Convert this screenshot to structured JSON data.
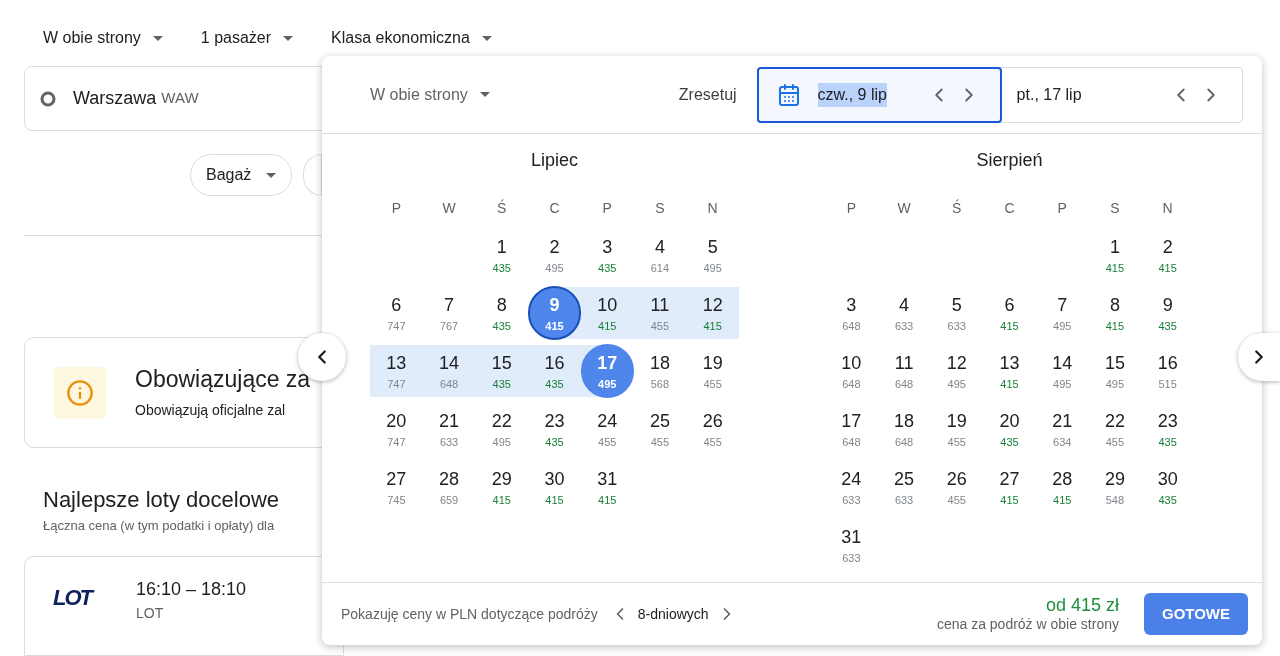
{
  "top_bar": {
    "dropdowns": [
      {
        "label": "W obie strony"
      },
      {
        "label": "1 pasażer"
      },
      {
        "label": "Klasa ekonomiczna"
      }
    ]
  },
  "origin": {
    "city": "Warszawa",
    "code": "WAW"
  },
  "filters": [
    {
      "label": "Bagaż"
    }
  ],
  "notice": {
    "title": "Obowiązujące za",
    "text": "Obowiązują oficjalne zal"
  },
  "best_flights": {
    "title": "Najlepsze loty docelowe",
    "subtitle": "Łączna cena (w tym podatki i opłaty) dla"
  },
  "flight": {
    "logo": "LOT",
    "times": "16:10 – 18:10",
    "airline": "LOT"
  },
  "picker": {
    "trip_type": "W obie strony",
    "reset": "Zresetuj",
    "fields": [
      {
        "value": "czw., 9 lip",
        "active": true
      },
      {
        "value": "pt., 17 lip",
        "active": false
      }
    ],
    "months": [
      {
        "name": "Lipiec",
        "weekdays": [
          "P",
          "W",
          "Ś",
          "C",
          "P",
          "S",
          "N"
        ],
        "weeks": [
          [
            {
              "kind": "blank"
            },
            {
              "kind": "blank"
            },
            {
              "kind": "day",
              "day": "1",
              "price": "435",
              "cheap": true
            },
            {
              "kind": "day",
              "day": "2",
              "price": "495",
              "cheap": false
            },
            {
              "kind": "day",
              "day": "3",
              "price": "435",
              "cheap": true
            },
            {
              "kind": "day",
              "day": "4",
              "price": "614",
              "cheap": false
            },
            {
              "kind": "day",
              "day": "5",
              "price": "495",
              "cheap": false
            }
          ],
          [
            {
              "kind": "day",
              "day": "6",
              "price": "747",
              "cheap": false
            },
            {
              "kind": "day",
              "day": "7",
              "price": "767",
              "cheap": false
            },
            {
              "kind": "day",
              "day": "8",
              "price": "435",
              "cheap": true
            },
            {
              "kind": "day",
              "day": "9",
              "price": "415",
              "range_start": true
            },
            {
              "kind": "day",
              "day": "10",
              "price": "415",
              "cheap": true,
              "in_range": true
            },
            {
              "kind": "day",
              "day": "11",
              "price": "455",
              "cheap": false,
              "in_range": true
            },
            {
              "kind": "day",
              "day": "12",
              "price": "415",
              "cheap": true,
              "in_range": true
            }
          ],
          [
            {
              "kind": "day",
              "day": "13",
              "price": "747",
              "cheap": false,
              "in_range": true
            },
            {
              "kind": "day",
              "day": "14",
              "price": "648",
              "cheap": false,
              "in_range": true
            },
            {
              "kind": "day",
              "day": "15",
              "price": "435",
              "cheap": true,
              "in_range": true
            },
            {
              "kind": "day",
              "day": "16",
              "price": "435",
              "cheap": true,
              "in_range": true
            },
            {
              "kind": "day",
              "day": "17",
              "price": "495",
              "range_end": true
            },
            {
              "kind": "day",
              "day": "18",
              "price": "568",
              "cheap": false
            },
            {
              "kind": "day",
              "day": "19",
              "price": "455",
              "cheap": false
            }
          ],
          [
            {
              "kind": "day",
              "day": "20",
              "price": "747",
              "cheap": false
            },
            {
              "kind": "day",
              "day": "21",
              "price": "633",
              "cheap": false
            },
            {
              "kind": "day",
              "day": "22",
              "price": "495",
              "cheap": false
            },
            {
              "kind": "day",
              "day": "23",
              "price": "435",
              "cheap": true
            },
            {
              "kind": "day",
              "day": "24",
              "price": "455",
              "cheap": false
            },
            {
              "kind": "day",
              "day": "25",
              "price": "455",
              "cheap": false
            },
            {
              "kind": "day",
              "day": "26",
              "price": "455",
              "cheap": false
            }
          ],
          [
            {
              "kind": "day",
              "day": "27",
              "price": "745",
              "cheap": false
            },
            {
              "kind": "day",
              "day": "28",
              "price": "659",
              "cheap": false
            },
            {
              "kind": "day",
              "day": "29",
              "price": "415",
              "cheap": true
            },
            {
              "kind": "day",
              "day": "30",
              "price": "415",
              "cheap": true
            },
            {
              "kind": "day",
              "day": "31",
              "price": "415",
              "cheap": true
            }
          ]
        ]
      },
      {
        "name": "Sierpień",
        "weekdays": [
          "P",
          "W",
          "Ś",
          "C",
          "P",
          "S",
          "N"
        ],
        "weeks": [
          [
            {
              "kind": "blank"
            },
            {
              "kind": "blank"
            },
            {
              "kind": "blank"
            },
            {
              "kind": "blank"
            },
            {
              "kind": "blank"
            },
            {
              "kind": "day",
              "day": "1",
              "price": "415",
              "cheap": true
            },
            {
              "kind": "day",
              "day": "2",
              "price": "415",
              "cheap": true
            }
          ],
          [
            {
              "kind": "day",
              "day": "3",
              "price": "648",
              "cheap": false
            },
            {
              "kind": "day",
              "day": "4",
              "price": "633",
              "cheap": false
            },
            {
              "kind": "day",
              "day": "5",
              "price": "633",
              "cheap": false
            },
            {
              "kind": "day",
              "day": "6",
              "price": "415",
              "cheap": true
            },
            {
              "kind": "day",
              "day": "7",
              "price": "495",
              "cheap": false
            },
            {
              "kind": "day",
              "day": "8",
              "price": "415",
              "cheap": true
            },
            {
              "kind": "day",
              "day": "9",
              "price": "435",
              "cheap": true
            }
          ],
          [
            {
              "kind": "day",
              "day": "10",
              "price": "648",
              "cheap": false
            },
            {
              "kind": "day",
              "day": "11",
              "price": "648",
              "cheap": false
            },
            {
              "kind": "day",
              "day": "12",
              "price": "495",
              "cheap": false
            },
            {
              "kind": "day",
              "day": "13",
              "price": "415",
              "cheap": true
            },
            {
              "kind": "day",
              "day": "14",
              "price": "495",
              "cheap": false
            },
            {
              "kind": "day",
              "day": "15",
              "price": "495",
              "cheap": false
            },
            {
              "kind": "day",
              "day": "16",
              "price": "515",
              "cheap": false
            }
          ],
          [
            {
              "kind": "day",
              "day": "17",
              "price": "648",
              "cheap": false
            },
            {
              "kind": "day",
              "day": "18",
              "price": "648",
              "cheap": false
            },
            {
              "kind": "day",
              "day": "19",
              "price": "455",
              "cheap": false
            },
            {
              "kind": "day",
              "day": "20",
              "price": "435",
              "cheap": true
            },
            {
              "kind": "day",
              "day": "21",
              "price": "634",
              "cheap": false
            },
            {
              "kind": "day",
              "day": "22",
              "price": "455",
              "cheap": false
            },
            {
              "kind": "day",
              "day": "23",
              "price": "435",
              "cheap": true
            }
          ],
          [
            {
              "kind": "day",
              "day": "24",
              "price": "633",
              "cheap": false
            },
            {
              "kind": "day",
              "day": "25",
              "price": "633",
              "cheap": false
            },
            {
              "kind": "day",
              "day": "26",
              "price": "455",
              "cheap": false
            },
            {
              "kind": "day",
              "day": "27",
              "price": "415",
              "cheap": true
            },
            {
              "kind": "day",
              "day": "28",
              "price": "415",
              "cheap": true
            },
            {
              "kind": "day",
              "day": "29",
              "price": "548",
              "cheap": false
            },
            {
              "kind": "day",
              "day": "30",
              "price": "435",
              "cheap": true
            }
          ],
          [
            {
              "kind": "day",
              "day": "31",
              "price": "633",
              "cheap": false
            }
          ]
        ]
      }
    ],
    "footer": {
      "note": "Pokazuję ceny w PLN dotyczące podróży",
      "duration": "8-dniowych",
      "price": "od 415 zł",
      "price_caption": "cena za podróż w obie strony",
      "done": "GOTOWE"
    }
  }
}
